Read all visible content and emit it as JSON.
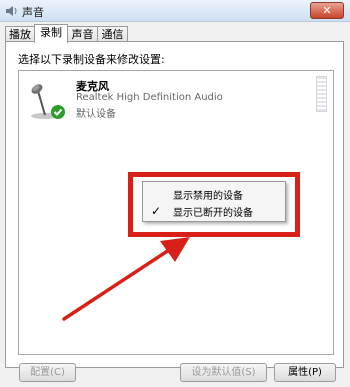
{
  "window": {
    "title": "声音",
    "close_glyph": "✕"
  },
  "tabs": [
    {
      "label": "播放"
    },
    {
      "label": "录制"
    },
    {
      "label": "声音"
    },
    {
      "label": "通信"
    }
  ],
  "panel": {
    "instruction": "选择以下录制设备来修改设置:"
  },
  "device": {
    "name": "麦克风",
    "description": "Realtek High Definition Audio",
    "status": "默认设备"
  },
  "context_menu": {
    "items": [
      {
        "label": "显示禁用的设备",
        "checked": false,
        "check_glyph": ""
      },
      {
        "label": "显示已断开的设备",
        "checked": true,
        "check_glyph": "✓"
      }
    ]
  },
  "buttons": {
    "configure": "配置(C)",
    "set_default": "设为默认值(S)",
    "properties": "属性(P)"
  },
  "colors": {
    "highlight": "#d92018",
    "arrow": "#d92018",
    "default_check": "#2e9b2e"
  }
}
